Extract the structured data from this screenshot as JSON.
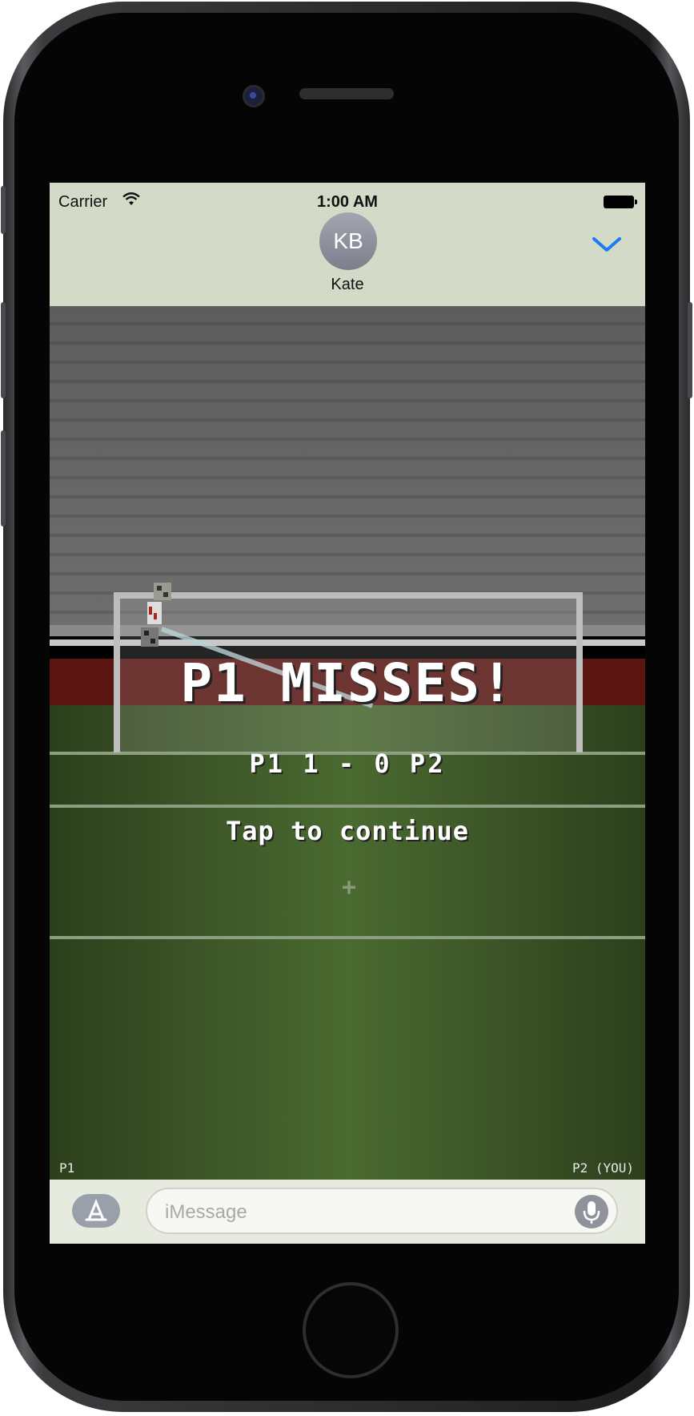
{
  "status_bar": {
    "carrier": "Carrier",
    "time": "1:00 AM"
  },
  "conversation": {
    "avatar_initials": "KB",
    "contact_name": "Kate"
  },
  "game": {
    "headline": "P1 MISSES!",
    "score": "P1  1 - 0  P2",
    "prompt": "Tap to continue",
    "p1_label": "P1",
    "p2_label": "P2 (YOU)"
  },
  "compose": {
    "placeholder": "iMessage"
  },
  "colors": {
    "header_bg": "#d3dbc8",
    "accent": "#1a7bf2",
    "banner": "#5a1510",
    "pitch": "#3a5226"
  },
  "icons": [
    "wifi-icon",
    "battery-icon",
    "chevron-down-icon",
    "app-store-icon",
    "microphone-icon"
  ]
}
